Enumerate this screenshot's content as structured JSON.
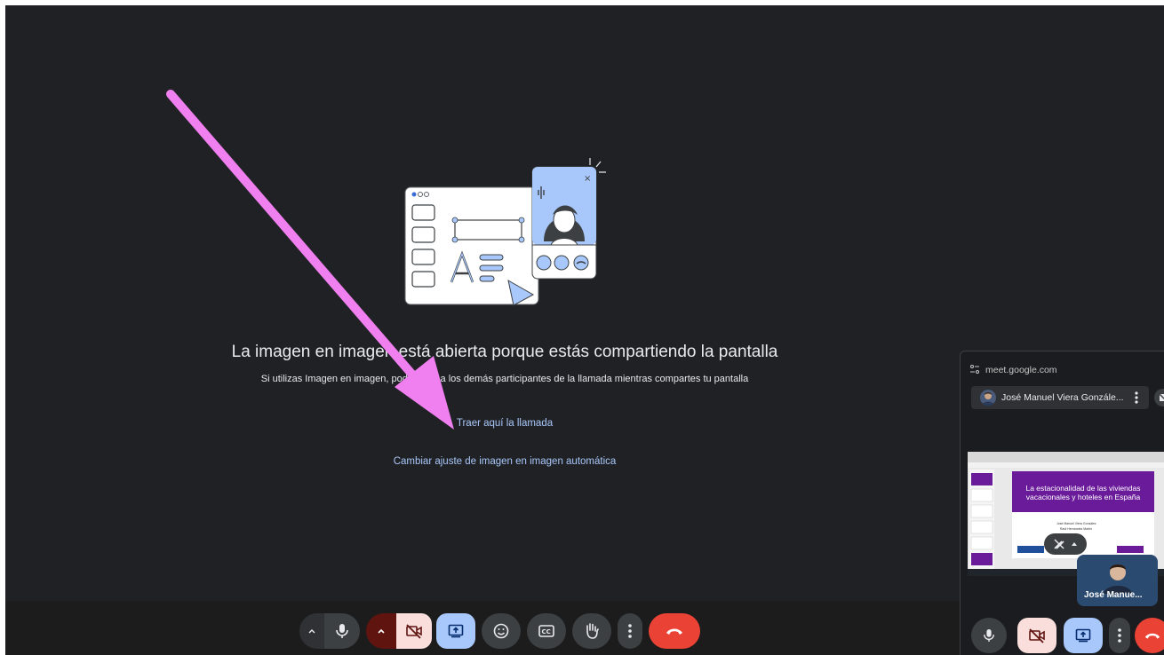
{
  "main": {
    "title": "La imagen en imagen está abierta porque estás compartiendo la pantalla",
    "subtitle": "Si utilizas Imagen en imagen, podrás ver a los demás participantes de la llamada mientras compartes tu pantalla",
    "bring_call_link": "Traer aquí la llamada",
    "auto_setting_link": "Cambiar ajuste de imagen en imagen automática"
  },
  "toolbar": {
    "buttons": [
      "audio-options",
      "microphone",
      "video-options",
      "camera-off",
      "present-screen",
      "reactions",
      "captions",
      "raise-hand",
      "more-options",
      "leave-call"
    ]
  },
  "pip": {
    "url": "meet.google.com",
    "pinned_name": "José Manuel Viera Gonzále...",
    "tile_name": "José Manue...",
    "slide": {
      "title": "La estacionalidad de las viviendas vacacionales y hoteles en España"
    }
  },
  "colors": {
    "background": "#202124",
    "bar": "#1c1c1c",
    "link": "#a8c7fa",
    "danger": "#ea4335",
    "camera_off_bg": "#f9dedc",
    "camera_off_dark": "#601410",
    "present_bg": "#a8c7fa",
    "control_bg": "#3c4043",
    "arrow": "#f07ff0",
    "slide_purple": "#6a1b9a"
  }
}
